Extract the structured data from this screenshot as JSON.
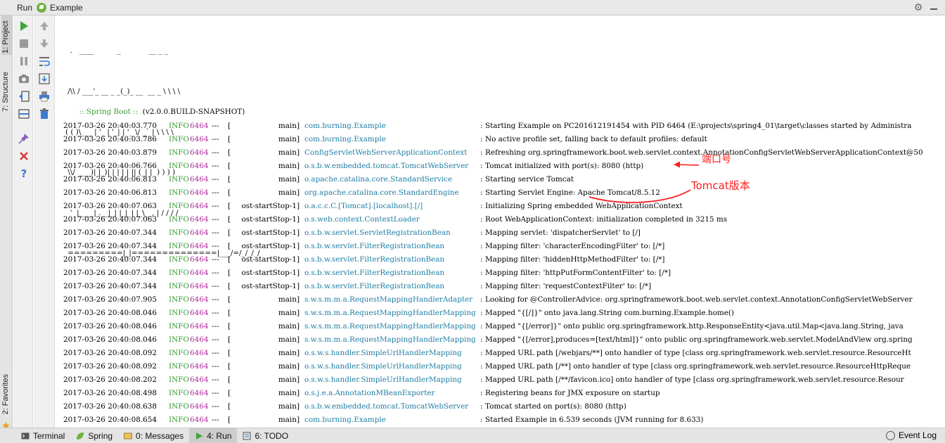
{
  "window": {
    "title_run": "Run",
    "run_config": "Example"
  },
  "left_tabs": [
    "1: Project",
    "7: Structure",
    "2: Favorites"
  ],
  "banner": [
    "  .   ____          _            __ _ _",
    " /\\\\ / ___'_ __ _ _(_)_ __  __ _ \\ \\ \\ \\",
    "( ( )\\___ | '_ | '_| | '_ \\/ _` | \\ \\ \\ \\",
    " \\\\/  ___)| |_)| | | | | || (_| |  ) ) ) )",
    "  '  |____| .__|_| |_|_| |_\\__, | / / / /",
    " =========|_|==============|___/=/_/_/_/"
  ],
  "boot": {
    "label": " :: Spring Boot ::  ",
    "version": "(v2.0.0.BUILD-SNAPSHOT)"
  },
  "log_rows": [
    {
      "ts": "2017-03-26 20:40:03.770",
      "level": "INFO",
      "pid": "6464",
      "sep": "---",
      "thread": "main]",
      "bracket": "[",
      "logger": "com.burning.Example",
      "msg": "Starting Example on PC201612191454 with PID 6464 (E:\\projects\\spring4_01\\target\\classes started by Administra"
    },
    {
      "ts": "2017-03-26 20:40:03.786",
      "level": "INFO",
      "pid": "6464",
      "sep": "---",
      "thread": "main]",
      "bracket": "[",
      "logger": "com.burning.Example",
      "msg": "No active profile set, falling back to default profiles: default"
    },
    {
      "ts": "2017-03-26 20:40:03.879",
      "level": "INFO",
      "pid": "6464",
      "sep": "---",
      "thread": "main]",
      "bracket": "[",
      "logger": "ConfigServletWebServerApplicationContext",
      "msg": "Refreshing org.springframework.boot.web.servlet.context.AnnotationConfigServletWebServerApplicationContext@50"
    },
    {
      "ts": "2017-03-26 20:40:06.766",
      "level": "INFO",
      "pid": "6464",
      "sep": "---",
      "thread": "main]",
      "bracket": "[",
      "logger": "o.s.b.w.embedded.tomcat.TomcatWebServer",
      "msg": "Tomcat initialized with port(s): 8080 (http)"
    },
    {
      "ts": "2017-03-26 20:40:06.813",
      "level": "INFO",
      "pid": "6464",
      "sep": "---",
      "thread": "main]",
      "bracket": "[",
      "logger": "o.apache.catalina.core.StandardService",
      "msg": "Starting service Tomcat"
    },
    {
      "ts": "2017-03-26 20:40:06.813",
      "level": "INFO",
      "pid": "6464",
      "sep": "---",
      "thread": "main]",
      "bracket": "[",
      "logger": "org.apache.catalina.core.StandardEngine",
      "msg": "Starting Servlet Engine: Apache Tomcat/8.5.12"
    },
    {
      "ts": "2017-03-26 20:40:07.063",
      "level": "INFO",
      "pid": "6464",
      "sep": "---",
      "thread": "ost-startStop-1]",
      "bracket": "[",
      "logger": "o.a.c.c.C.[Tomcat].[localhost].[/]",
      "msg": "Initializing Spring embedded WebApplicationContext"
    },
    {
      "ts": "2017-03-26 20:40:07.063",
      "level": "INFO",
      "pid": "6464",
      "sep": "---",
      "thread": "ost-startStop-1]",
      "bracket": "[",
      "logger": "o.s.web.context.ContextLoader",
      "msg": "Root WebApplicationContext: initialization completed in 3215 ms"
    },
    {
      "ts": "2017-03-26 20:40:07.344",
      "level": "INFO",
      "pid": "6464",
      "sep": "---",
      "thread": "ost-startStop-1]",
      "bracket": "[",
      "logger": "o.s.b.w.servlet.ServletRegistrationBean",
      "msg": "Mapping servlet: 'dispatcherServlet' to [/]"
    },
    {
      "ts": "2017-03-26 20:40:07.344",
      "level": "INFO",
      "pid": "6464",
      "sep": "---",
      "thread": "ost-startStop-1]",
      "bracket": "[",
      "logger": "o.s.b.w.servlet.FilterRegistrationBean",
      "msg": "Mapping filter: 'characterEncodingFilter' to: [/*]"
    },
    {
      "ts": "2017-03-26 20:40:07.344",
      "level": "INFO",
      "pid": "6464",
      "sep": "---",
      "thread": "ost-startStop-1]",
      "bracket": "[",
      "logger": "o.s.b.w.servlet.FilterRegistrationBean",
      "msg": "Mapping filter: 'hiddenHttpMethodFilter' to: [/*]"
    },
    {
      "ts": "2017-03-26 20:40:07.344",
      "level": "INFO",
      "pid": "6464",
      "sep": "---",
      "thread": "ost-startStop-1]",
      "bracket": "[",
      "logger": "o.s.b.w.servlet.FilterRegistrationBean",
      "msg": "Mapping filter: 'httpPutFormContentFilter' to: [/*]"
    },
    {
      "ts": "2017-03-26 20:40:07.344",
      "level": "INFO",
      "pid": "6464",
      "sep": "---",
      "thread": "ost-startStop-1]",
      "bracket": "[",
      "logger": "o.s.b.w.servlet.FilterRegistrationBean",
      "msg": "Mapping filter: 'requestContextFilter' to: [/*]"
    },
    {
      "ts": "2017-03-26 20:40:07.905",
      "level": "INFO",
      "pid": "6464",
      "sep": "---",
      "thread": "main]",
      "bracket": "[",
      "logger": "s.w.s.m.m.a.RequestMappingHandlerAdapter",
      "msg": "Looking for @ControllerAdvice: org.springframework.boot.web.servlet.context.AnnotationConfigServletWebServer"
    },
    {
      "ts": "2017-03-26 20:40:08.046",
      "level": "INFO",
      "pid": "6464",
      "sep": "---",
      "thread": "main]",
      "bracket": "[",
      "logger": "s.w.s.m.m.a.RequestMappingHandlerMapping",
      "msg": "Mapped \"{[/]}\" onto java.lang.String com.burning.Example.home()"
    },
    {
      "ts": "2017-03-26 20:40:08.046",
      "level": "INFO",
      "pid": "6464",
      "sep": "---",
      "thread": "main]",
      "bracket": "[",
      "logger": "s.w.s.m.m.a.RequestMappingHandlerMapping",
      "msg": "Mapped \"{[/error]}\" onto public org.springframework.http.ResponseEntity<java.util.Map<java.lang.String, java"
    },
    {
      "ts": "2017-03-26 20:40:08.046",
      "level": "INFO",
      "pid": "6464",
      "sep": "---",
      "thread": "main]",
      "bracket": "[",
      "logger": "s.w.s.m.m.a.RequestMappingHandlerMapping",
      "msg": "Mapped \"{[/error],produces=[text/html]}\" onto public org.springframework.web.servlet.ModelAndView org.spring"
    },
    {
      "ts": "2017-03-26 20:40:08.092",
      "level": "INFO",
      "pid": "6464",
      "sep": "---",
      "thread": "main]",
      "bracket": "[",
      "logger": "o.s.w.s.handler.SimpleUrlHandlerMapping",
      "msg": "Mapped URL path [/webjars/**] onto handler of type [class org.springframework.web.servlet.resource.ResourceHt"
    },
    {
      "ts": "2017-03-26 20:40:08.092",
      "level": "INFO",
      "pid": "6464",
      "sep": "---",
      "thread": "main]",
      "bracket": "[",
      "logger": "o.s.w.s.handler.SimpleUrlHandlerMapping",
      "msg": "Mapped URL path [/**] onto handler of type [class org.springframework.web.servlet.resource.ResourceHttpReque"
    },
    {
      "ts": "2017-03-26 20:40:08.202",
      "level": "INFO",
      "pid": "6464",
      "sep": "---",
      "thread": "main]",
      "bracket": "[",
      "logger": "o.s.w.s.handler.SimpleUrlHandlerMapping",
      "msg": "Mapped URL path [/**/favicon.ico] onto handler of type [class org.springframework.web.servlet.resource.Resour"
    },
    {
      "ts": "2017-03-26 20:40:08.498",
      "level": "INFO",
      "pid": "6464",
      "sep": "---",
      "thread": "main]",
      "bracket": "[",
      "logger": "o.s.j.e.a.AnnotationMBeanExporter",
      "msg": "Registering beans for JMX exposure on startup"
    },
    {
      "ts": "2017-03-26 20:40:08.638",
      "level": "INFO",
      "pid": "6464",
      "sep": "---",
      "thread": "main]",
      "bracket": "[",
      "logger": "o.s.b.w.embedded.tomcat.TomcatWebServer",
      "msg": "Tomcat started on port(s): 8080 (http)"
    },
    {
      "ts": "2017-03-26 20:40:08.654",
      "level": "INFO",
      "pid": "6464",
      "sep": "---",
      "thread": "main]",
      "bracket": "[",
      "logger": "com.burning.Example",
      "msg": "Started Example in 6.539 seconds (JVM running for 8.633)"
    }
  ],
  "annotations": {
    "port": "端口号",
    "tomcat": "Tomcat版本"
  },
  "bottom_tabs": [
    {
      "label": "Terminal",
      "icon": "terminal-icon"
    },
    {
      "label": "Spring",
      "icon": "spring-icon"
    },
    {
      "label": "0: Messages",
      "icon": "messages-icon"
    },
    {
      "label": "4: Run",
      "icon": "run-icon",
      "active": true
    },
    {
      "label": "6: TODO",
      "icon": "todo-icon"
    }
  ],
  "event_log": "Event Log",
  "colors": {
    "level": "#2e9e2e",
    "pid": "#b5249e",
    "logger": "#1f7ea3",
    "annotation": "#ff1c1c",
    "boot_label": "#3a9a3a"
  }
}
